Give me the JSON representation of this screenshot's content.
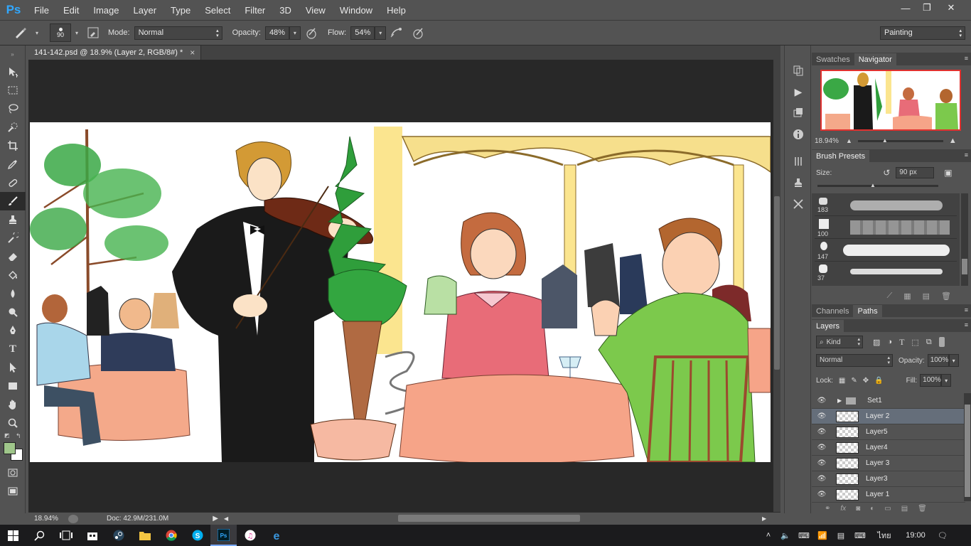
{
  "app": {
    "logo": "Ps"
  },
  "menu": [
    "File",
    "Edit",
    "Image",
    "Layer",
    "Type",
    "Select",
    "Filter",
    "3D",
    "View",
    "Window",
    "Help"
  ],
  "window_controls": {
    "minimize": "—",
    "restore": "❐",
    "close": "✕"
  },
  "options": {
    "brush_size": "90",
    "mode_label": "Mode:",
    "mode_value": "Normal",
    "opacity_label": "Opacity:",
    "opacity_value": "48%",
    "flow_label": "Flow:",
    "flow_value": "54%",
    "workspace": "Painting"
  },
  "document": {
    "tab_title": "141-142.psd @ 18.9% (Layer 2, RGB/8#) *",
    "tab_close": "×",
    "zoom": "18.94%",
    "doc_size": "Doc: 42.9M/231.0M"
  },
  "panels": {
    "top_tabs": [
      "Swatches",
      "Navigator"
    ],
    "navigator_zoom": "18.94%",
    "brush_presets_title": "Brush Presets",
    "size_label": "Size:",
    "size_value": "90 px",
    "brush_sizes": [
      "183",
      "100",
      "147",
      "37"
    ],
    "mid_tabs": [
      "Channels",
      "Paths"
    ],
    "layers_title": "Layers",
    "kind_label": "Kind",
    "blend_mode": "Normal",
    "opacity_label": "Opacity:",
    "opacity_value": "100%",
    "lock_label": "Lock:",
    "fill_label": "Fill:",
    "fill_value": "100%",
    "layers": [
      {
        "name": "Set1",
        "type": "group"
      },
      {
        "name": "Layer 2",
        "type": "layer",
        "selected": true
      },
      {
        "name": "Layer5",
        "type": "layer"
      },
      {
        "name": "Layer4",
        "type": "layer"
      },
      {
        "name": "Layer 3",
        "type": "layer"
      },
      {
        "name": "Layer3",
        "type": "layer"
      },
      {
        "name": "Layer 1",
        "type": "layer"
      }
    ]
  },
  "taskbar": {
    "language": "ไทย",
    "time": "19:00"
  },
  "colors": {
    "ui_bg": "#535353",
    "canvas_bg": "#282828",
    "foreground": "#9fc68a",
    "background": "#ffffff",
    "accent": "#31a8ff"
  }
}
